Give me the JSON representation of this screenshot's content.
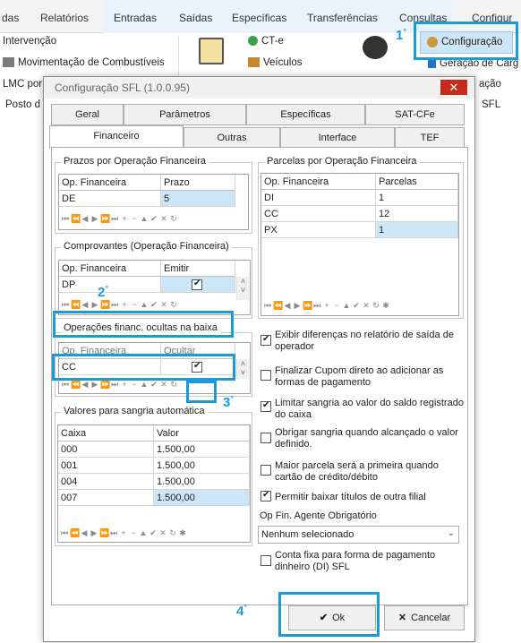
{
  "ribbon": {
    "tabs": [
      "das",
      "Relatórios",
      "Entradas",
      "Saídas",
      "Específicas",
      "Transferências",
      "Consultas",
      "Configur"
    ],
    "items": {
      "intervencao": "Intervenção",
      "movimentacao": "Movimentação de Combustíveis",
      "lmc": "LMC por",
      "posto": "Posto d",
      "cte": "CT-e",
      "veiculos": "Veículos",
      "configuracao": "Configuração",
      "geracao": "Geração de Carg",
      "acao": "ação",
      "sfl": "SFL"
    }
  },
  "dialog": {
    "title": "Configuração SFL (1.0.0.95)",
    "tabs_row1": [
      "Geral",
      "Parâmetros",
      "Específicas",
      "SAT-CFe"
    ],
    "tabs_row2": [
      "Financeiro",
      "Outras",
      "Interface",
      "TEF"
    ],
    "prazos": {
      "title": "Prazos por Operação Financeira",
      "cols": [
        "Op. Financeira",
        "Prazo"
      ],
      "rows": [
        [
          "DE",
          "5"
        ]
      ]
    },
    "parcelas": {
      "title": "Parcelas por Operação Financeira",
      "cols": [
        "Op. Financeira",
        "Parcelas"
      ],
      "rows": [
        [
          "DI",
          "1"
        ],
        [
          "CC",
          "12"
        ],
        [
          "PX",
          "1"
        ]
      ]
    },
    "comprovantes": {
      "title": "Comprovantes (Operação Financeira)",
      "cols": [
        "Op. Financeira",
        "Emitir"
      ],
      "rows": [
        [
          "DP",
          ""
        ]
      ]
    },
    "ocultas": {
      "title": "Operações financ. ocultas na baixa",
      "cols": [
        "Op. Financeira",
        "Ocultar"
      ],
      "rows": [
        [
          "CC",
          ""
        ]
      ]
    },
    "sangria": {
      "title": "Valores para sangria automática",
      "cols": [
        "Caixa",
        "Valor"
      ],
      "rows": [
        [
          "000",
          "1.500,00"
        ],
        [
          "001",
          "1.500,00"
        ],
        [
          "004",
          "1.500,00"
        ],
        [
          "007",
          "1.500,00"
        ]
      ]
    },
    "options": [
      {
        "label": "Exibir diferenças no relatório de saída de operador",
        "checked": true
      },
      {
        "label": "Finalizar Cupom direto ao adicionar as formas de pagamento",
        "checked": false
      },
      {
        "label": "Limitar sangria ao valor do saldo registrado do caixa",
        "checked": true
      },
      {
        "label": "Obrigar sangria quando alcançado o valor definido.",
        "checked": false
      },
      {
        "label": "Maior parcela será a primeira quando cartão de crédito/débito",
        "checked": false
      },
      {
        "label": "Permitir baixar títulos de outra filial",
        "checked": true
      }
    ],
    "agente_label": "Op Fin. Agente Obrigatório",
    "agente_value": "Nenhum selecionado",
    "conta_fixa": {
      "label": "Conta fixa para forma de pagamento dinheiro (DI) SFL",
      "checked": false
    },
    "ok": "Ok",
    "cancel": "Cancelar"
  },
  "annotations": {
    "n1": "1",
    "n2": "2",
    "n3": "3",
    "n4": "4",
    "deg": "°"
  },
  "colors": {
    "highlight": "#1a9bd7",
    "close": "#c42b1c"
  }
}
